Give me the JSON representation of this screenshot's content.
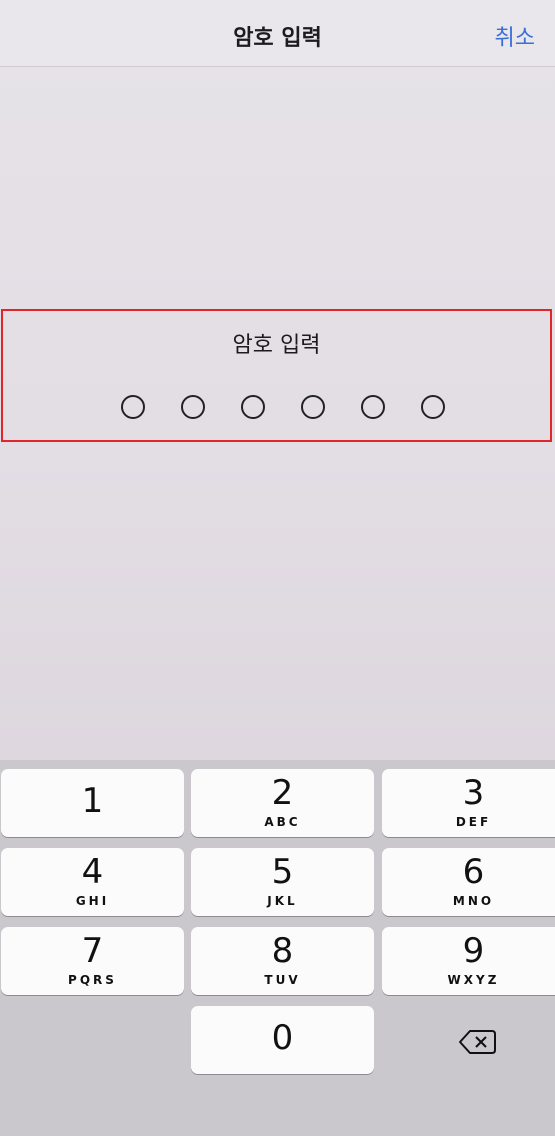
{
  "nav": {
    "title": "암호 입력",
    "cancel_label": "취소"
  },
  "passcode": {
    "label": "암호 입력",
    "length": 6,
    "entered": 0
  },
  "keypad": {
    "keys": [
      {
        "num": "1",
        "letters": ""
      },
      {
        "num": "2",
        "letters": "ABC"
      },
      {
        "num": "3",
        "letters": "DEF"
      },
      {
        "num": "4",
        "letters": "GHI"
      },
      {
        "num": "5",
        "letters": "JKL"
      },
      {
        "num": "6",
        "letters": "MNO"
      },
      {
        "num": "7",
        "letters": "PQRS"
      },
      {
        "num": "8",
        "letters": "TUV"
      },
      {
        "num": "9",
        "letters": "WXYZ"
      },
      {
        "num": "0",
        "letters": ""
      }
    ],
    "delete_icon": "backspace-icon"
  },
  "colors": {
    "accent": "#3a6fd6",
    "highlight_border": "#e1262b"
  }
}
